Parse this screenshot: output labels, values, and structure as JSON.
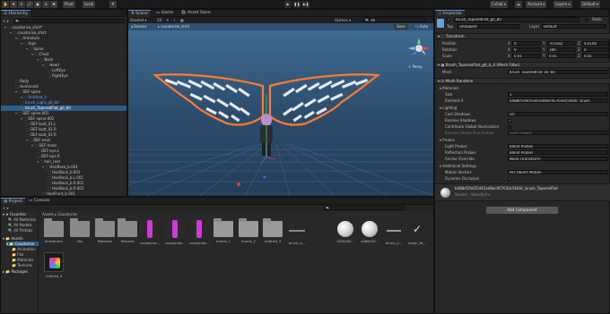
{
  "toolbar": {
    "pivot": "Pivot",
    "local": "Local",
    "collab": "Collab",
    "account": "Account",
    "layers": "Layers",
    "layout": "Default"
  },
  "hierarchy": {
    "tab": "Hierarchy",
    "rows": [
      {
        "text": "couatorise_shirt*"
      },
      {
        "text": "couatorise_shirt"
      },
      {
        "text": "Armature"
      },
      {
        "text": "Hips"
      },
      {
        "text": "Spine"
      },
      {
        "text": "Chest"
      },
      {
        "text": "Neck"
      },
      {
        "text": "Head"
      },
      {
        "text": "LeftEye"
      },
      {
        "text": "RightEye"
      },
      {
        "text": "Body"
      },
      {
        "text": "Humanoid"
      },
      {
        "text": "DEF-spine"
      },
      {
        "text": "Untitled_3"
      },
      {
        "text": "brush_Light_g0_b0"
      },
      {
        "text": "brush_TaperedFlat_g0_b0"
      },
      {
        "text": "DEF-spine.001"
      },
      {
        "text": "DEF-spine.002"
      },
      {
        "text": "DEF-butt_01.L"
      },
      {
        "text": "DEF-butt_01.R"
      },
      {
        "text": "DEF-butt_02.R"
      },
      {
        "text": "DEF-neck"
      },
      {
        "text": "DEF-head"
      },
      {
        "text": "DEF-eye.L"
      },
      {
        "text": "DEF-eye.R"
      },
      {
        "text": "hair_root"
      },
      {
        "text": "HairBack_b.001"
      },
      {
        "text": "HairBack_b.001"
      },
      {
        "text": "HairBack_b.L.001"
      },
      {
        "text": "HairBack_b.R.001"
      },
      {
        "text": "HairBack_b.R.003"
      },
      {
        "text": "HairFront_b.001"
      }
    ]
  },
  "scene": {
    "tab_scene": "Scene",
    "tab_game": "Game",
    "tab_store": "Asset Store",
    "shading": "Shaded",
    "mode_2d": "2D",
    "gizmos": "Gizmos",
    "search": "All",
    "breadcrumb_scenes": "Scenes",
    "breadcrumb_obj": "couatorise_shirt",
    "save": "Save",
    "persp": "< Persp"
  },
  "project": {
    "tab_project": "Project",
    "tab_console": "Console",
    "favorites": "Favorites",
    "fav_items": [
      "All Materials",
      "All Models",
      "All Prefabs"
    ],
    "assets": "Assets",
    "assets_tree": [
      "Couatorise",
      "Animation",
      "Fbx",
      "Materials",
      "Textures"
    ],
    "packages": "Packages",
    "breadcrumb_assets": "Assets",
    "breadcrumb_folder": "Couatorise",
    "items": [
      {
        "name": "Animations"
      },
      {
        "name": "Fbx"
      },
      {
        "name": "Materials"
      },
      {
        "name": "Textures"
      },
      {
        "name": "couatorise..."
      },
      {
        "name": "couatorise..."
      },
      {
        "name": "couatorise..."
      },
      {
        "name": "thumb_1"
      },
      {
        "name": "thumb_2"
      },
      {
        "name": "Untitled_3"
      },
      {
        "name": "brush_Li..."
      },
      {
        "name": "0245c63..."
      },
      {
        "name": "b488cf1f..."
      },
      {
        "name": "brush_Li..."
      },
      {
        "name": "brush_Ta..."
      }
    ],
    "second_row": [
      {
        "name": "Untitled_3"
      }
    ]
  },
  "inspector": {
    "tab": "Inspector",
    "object_name": "brush_TaperedFlat_g0_b0",
    "static": "Static",
    "tag_label": "Tag",
    "tag_value": "Untagged",
    "layer_label": "Layer",
    "layer_value": "Default",
    "transform": {
      "title": "Transform",
      "position": {
        "label": "Position",
        "x": "0",
        "y": "-0.0182",
        "z": "0.0106"
      },
      "rotation": {
        "label": "Rotation",
        "x": "0",
        "y": "180",
        "z": "0"
      },
      "scale": {
        "label": "Scale",
        "x": "0.01",
        "y": "0.01",
        "z": "0.01"
      }
    },
    "mesh_filter": {
      "title": "Brush_TaperedFlat_g0_b_0 (Mesh Filter)",
      "mesh_label": "Mesh",
      "mesh_value": "brush_TaperedFlat_g0_b0"
    },
    "mesh_renderer": {
      "title": "Mesh Renderer",
      "materials_label": "Materials",
      "size_label": "Size",
      "size_value": "1",
      "element_label": "Element 0",
      "element_value": "b488cf1fef25441ed8ec957030c5660c_brush_",
      "lighting_label": "Lighting",
      "cast_shadows_label": "Cast Shadows",
      "cast_shadows_value": "On",
      "receive_shadows_label": "Receive Shadows",
      "contribute_gi_label": "Contribute Global Illumination",
      "receive_gi_label": "Receive Global Illumination",
      "receive_gi_value": "Light Probes",
      "probes_label": "Probes",
      "light_probes_label": "Light Probes",
      "light_probes_value": "Blend Probes",
      "reflection_label": "Reflection Probes",
      "reflection_value": "Blend Probes",
      "anchor_label": "Anchor Override",
      "anchor_value": "None (Transform)",
      "additional_label": "Additional Settings",
      "motion_label": "Motion Vectors",
      "motion_value": "Per Object Motion",
      "dynamic_label": "Dynamic Occlusion"
    },
    "material": {
      "name": "b488cf1fef25441ed8ec957030c5660c_brush_TaperedFlat",
      "shader_label": "Shader",
      "shader_value": "Standard"
    },
    "add_component": "Add Component"
  },
  "colors": {
    "accent": "#2c5d87",
    "wing_outline": "#ff7a2e",
    "feathers": "#e8ecf6",
    "scene_bg": "#2f4d6d",
    "hair": "#c58bd4"
  }
}
